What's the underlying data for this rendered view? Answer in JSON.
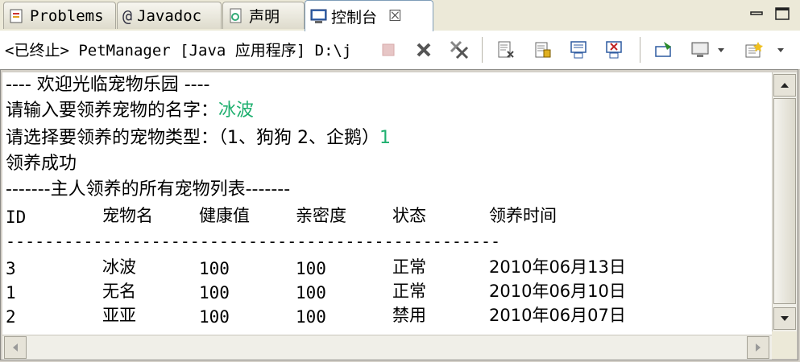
{
  "tabs": [
    {
      "label": "Problems",
      "icon": "problems-icon"
    },
    {
      "label": "Javadoc",
      "icon": "at-icon"
    },
    {
      "label": "声明",
      "icon": "declaration-icon"
    },
    {
      "label": "控制台",
      "icon": "console-icon",
      "active": true,
      "close": "☒"
    }
  ],
  "process_label": "<已终止> PetManager [Java 应用程序] D:\\j",
  "console": {
    "welcome": "---- 欢迎光临宠物乐园 ----",
    "prompt_name": "请输入要领养宠物的名字：",
    "input_name": "冰波",
    "prompt_type": "请选择要领养的宠物类型：（1、狗狗 2、企鹅）",
    "input_type": "1",
    "success": "领养成功",
    "list_title": "-------主人领养的所有宠物列表-------",
    "headers": [
      "ID",
      "宠物名",
      "健康值",
      "亲密度",
      "状态",
      "领养时间"
    ],
    "divider": "---------------------------------------------------",
    "rows": [
      [
        "3",
        "冰波",
        "100",
        "100",
        "正常",
        "2010年06月13日"
      ],
      [
        "1",
        "无名",
        "100",
        "100",
        "正常",
        "2010年06月10日"
      ],
      [
        "2",
        "亚亚",
        "100",
        "100",
        "禁用",
        "2010年06月07日"
      ]
    ]
  },
  "colors": {
    "input_green": "#20b070",
    "tab_bg": "#ece9d8"
  }
}
